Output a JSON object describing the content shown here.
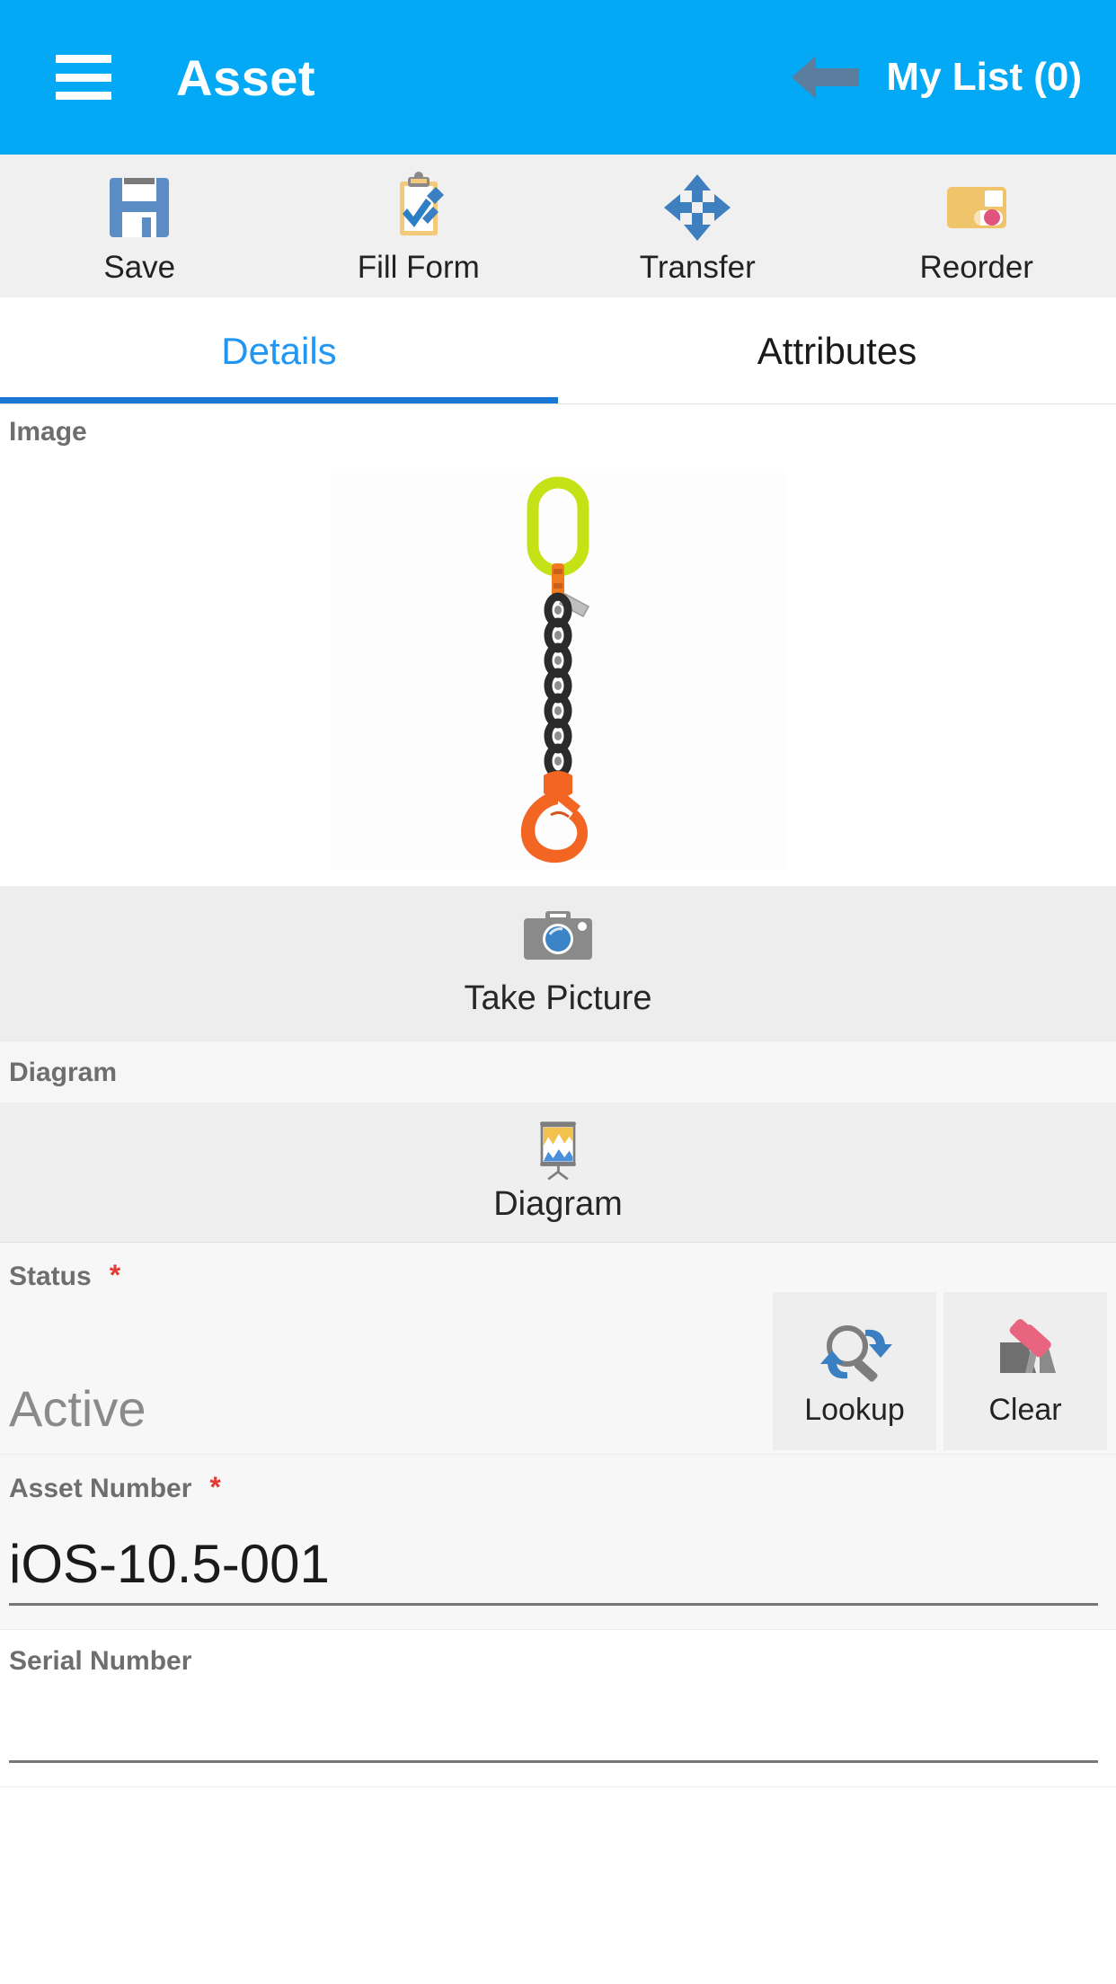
{
  "header": {
    "title": "Asset",
    "menu_icon": "hamburger-menu-icon",
    "back_icon": "back-arrow-icon",
    "my_list_label": "My List (0)",
    "background_color": "#03A9F4"
  },
  "toolbar": {
    "items": [
      {
        "label": "Save",
        "icon": "floppy-disk-icon"
      },
      {
        "label": "Fill Form",
        "icon": "clipboard-pencil-icon"
      },
      {
        "label": "Transfer",
        "icon": "four-way-arrows-icon"
      },
      {
        "label": "Reorder",
        "icon": "package-box-icon"
      }
    ]
  },
  "tabs": [
    {
      "label": "Details",
      "active": true
    },
    {
      "label": "Attributes",
      "active": false
    }
  ],
  "sections": {
    "image": {
      "label": "Image",
      "photo_alt": "chain-sling-with-hook",
      "take_picture": {
        "label": "Take Picture",
        "icon": "camera-icon"
      }
    },
    "diagram": {
      "label": "Diagram",
      "button": {
        "label": "Diagram",
        "icon": "presentation-chart-icon"
      }
    }
  },
  "fields": [
    {
      "label": "Status",
      "required": true,
      "required_marker": "*",
      "value": "Active",
      "buttons": [
        {
          "label": "Lookup",
          "icon": "magnifier-refresh-icon"
        },
        {
          "label": "Clear",
          "icon": "eraser-icon"
        }
      ]
    },
    {
      "label": "Asset Number",
      "required": true,
      "required_marker": "*",
      "value": "iOS-10.5-001"
    },
    {
      "label": "Serial Number",
      "required": false,
      "required_marker": "",
      "value": ""
    }
  ],
  "colors": {
    "accent": "#03A9F4",
    "tab_active": "#2196F3",
    "tab_underline": "#1976D2",
    "required": "#e53935",
    "label_gray": "#6e6e6e"
  }
}
